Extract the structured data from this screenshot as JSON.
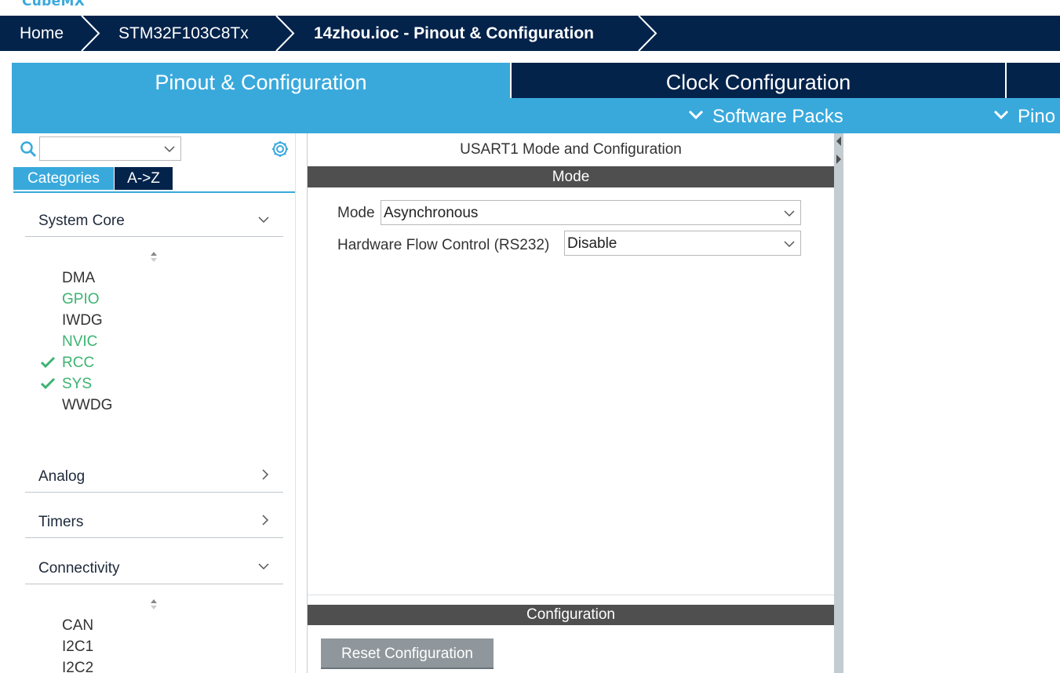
{
  "app": {
    "logo_text": "CubeMX"
  },
  "breadcrumb": {
    "items": [
      {
        "label": "Home"
      },
      {
        "label": "STM32F103C8Tx"
      },
      {
        "label": "14zhou.ioc - Pinout & Configuration"
      }
    ]
  },
  "tabs": {
    "pinout": "Pinout & Configuration",
    "clock": "Clock Configuration"
  },
  "submenu": {
    "software_packs": "Software Packs",
    "pinout": "Pino"
  },
  "sidebar": {
    "search_value": "",
    "tab_categories": "Categories",
    "tab_az": "A->Z",
    "system_core": {
      "label": "System Core",
      "items": [
        {
          "label": "DMA",
          "status": "normal"
        },
        {
          "label": "GPIO",
          "status": "configured"
        },
        {
          "label": "IWDG",
          "status": "normal"
        },
        {
          "label": "NVIC",
          "status": "configured"
        },
        {
          "label": "RCC",
          "status": "checked"
        },
        {
          "label": "SYS",
          "status": "checked"
        },
        {
          "label": "WWDG",
          "status": "normal"
        }
      ]
    },
    "analog": {
      "label": "Analog"
    },
    "timers": {
      "label": "Timers"
    },
    "connectivity": {
      "label": "Connectivity",
      "items": [
        {
          "label": "CAN"
        },
        {
          "label": "I2C1"
        },
        {
          "label": "I2C2"
        }
      ]
    }
  },
  "main": {
    "title": "USART1 Mode and Configuration",
    "mode_section": "Mode",
    "mode_label": "Mode",
    "mode_value": "Asynchronous",
    "flow_label": "Hardware Flow Control (RS232)",
    "flow_value": "Disable",
    "config_section": "Configuration",
    "reset_button": "Reset Configuration"
  },
  "colors": {
    "navy": "#03234b",
    "accent_blue": "#39a9dc",
    "green": "#3cb371",
    "section_bar": "#4f4f4f"
  }
}
